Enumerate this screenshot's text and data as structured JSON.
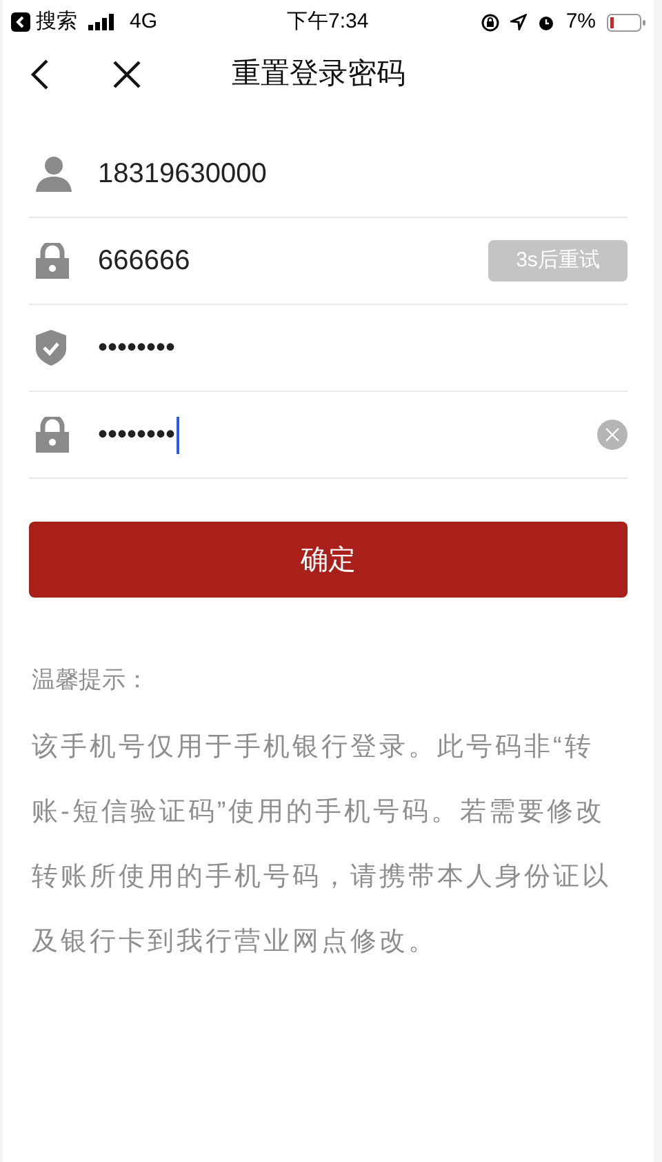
{
  "status_bar": {
    "back_app": "搜索",
    "network": "4G",
    "time": "下午7:34",
    "battery": "7%"
  },
  "nav": {
    "title": "重置登录密码"
  },
  "fields": [
    {
      "kind": "person",
      "value": "18319630000",
      "focused": false
    },
    {
      "kind": "lock",
      "value": "666666",
      "focused": false,
      "action": {
        "label": "3s后重试",
        "disabled": true
      }
    },
    {
      "kind": "shield",
      "value": "••••••••",
      "focused": false
    },
    {
      "kind": "lock",
      "value": "••••••••",
      "focused": true,
      "clearable": true
    }
  ],
  "submit": {
    "label": "确定"
  },
  "hint": {
    "title": "温馨提示：",
    "body": "该手机号仅用于手机银行登录。此号码非“转账-短信验证码”使用的手机号码。若需要修改转账所使用的手机号码，请携带本人身份证以及银行卡到我行营业网点修改。"
  }
}
